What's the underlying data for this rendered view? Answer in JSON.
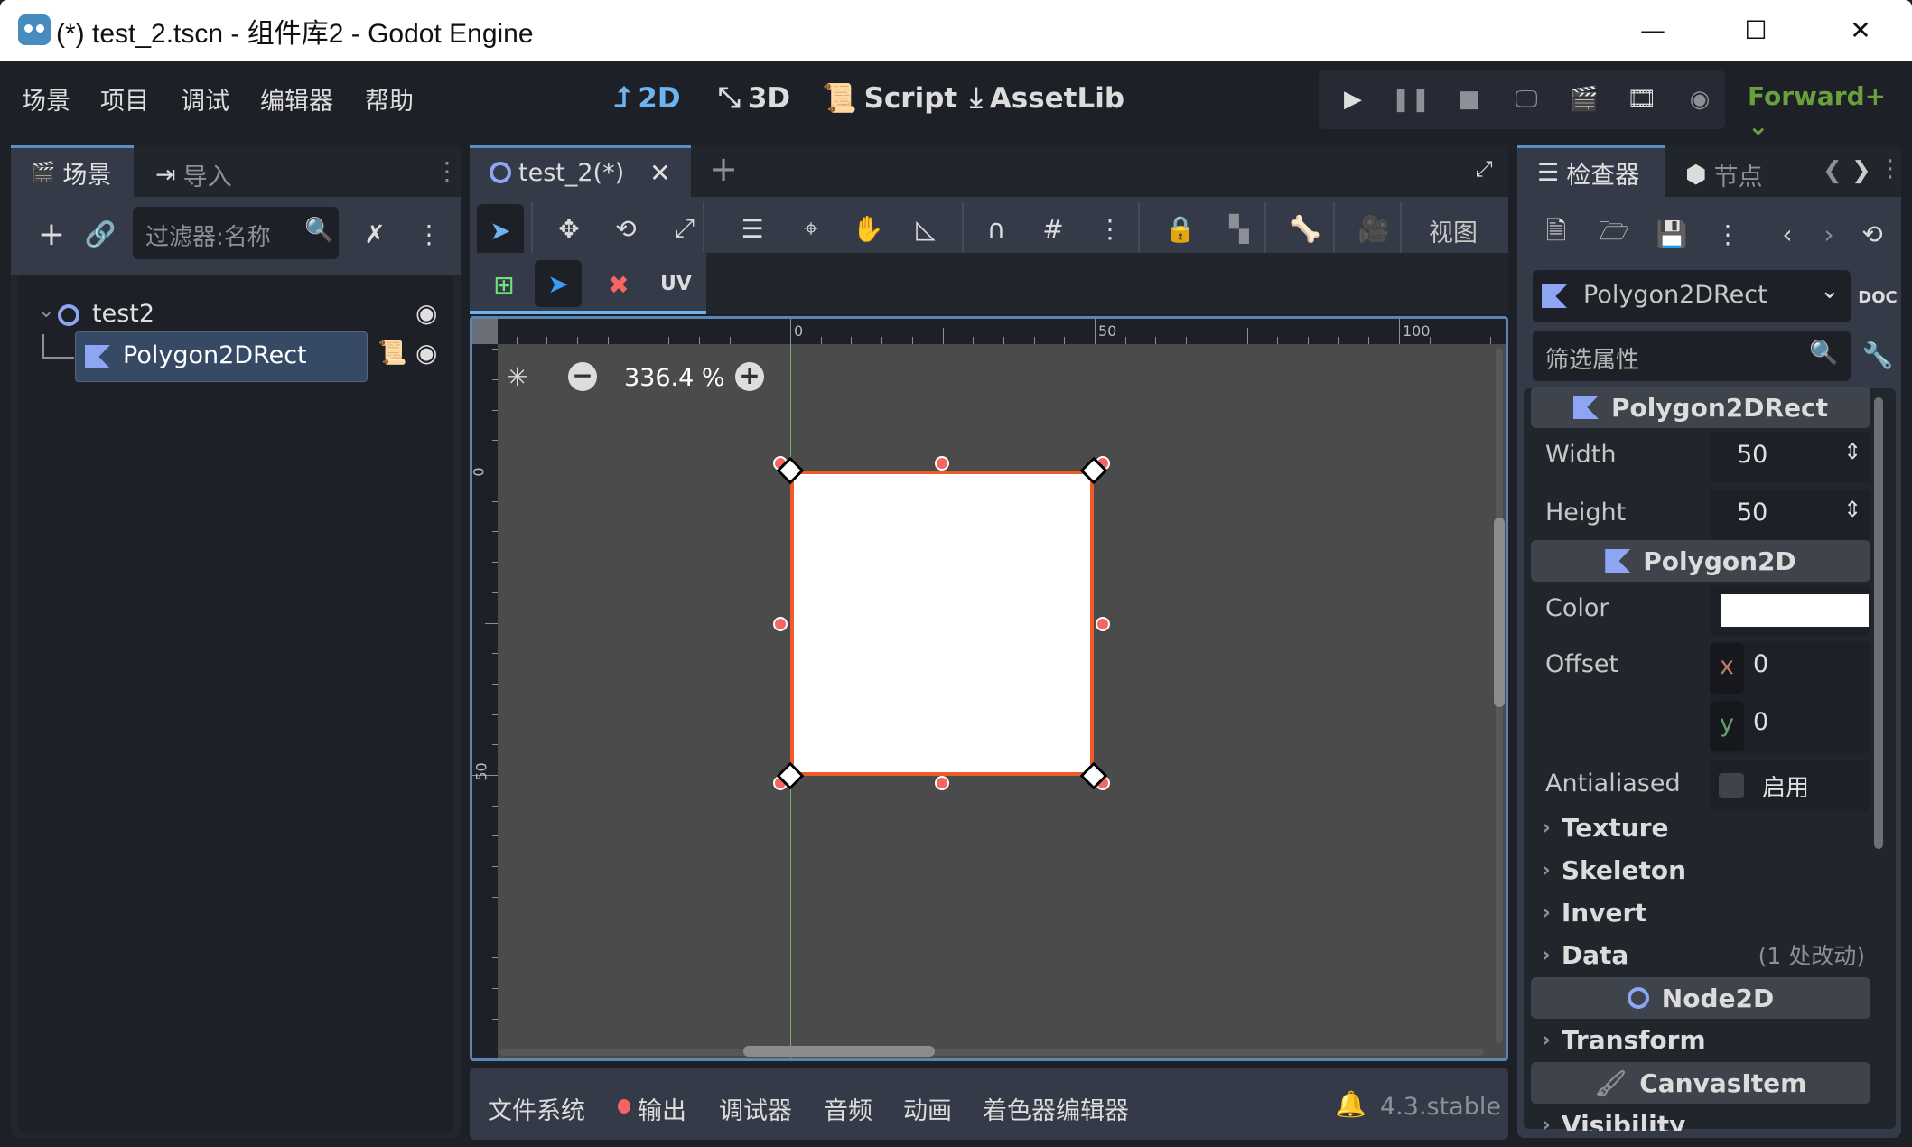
{
  "window": {
    "title": "(*) test_2.tscn - 组件库2 - Godot Engine",
    "controls": {
      "minimize": "—",
      "maximize": "☐",
      "close": "✕"
    }
  },
  "menu": {
    "items": [
      "场景",
      "项目",
      "调试",
      "编辑器",
      "帮助"
    ]
  },
  "workspaces": [
    {
      "label": "2D",
      "icon": "2d-icon",
      "active": true
    },
    {
      "label": "3D",
      "icon": "3d-icon",
      "active": false
    },
    {
      "label": "Script",
      "icon": "script-icon",
      "active": false
    },
    {
      "label": "AssetLib",
      "icon": "assetlib-icon",
      "active": false
    }
  ],
  "run_controls": [
    "play-icon",
    "pause-icon",
    "stop-icon",
    "remote-debug-icon",
    "play-scene-icon",
    "play-custom-scene-icon",
    "movie-maker-icon"
  ],
  "renderer": {
    "label": "Forward+",
    "color": "#6a9f3c"
  },
  "scene_dock": {
    "tabs": [
      {
        "label": "场景",
        "active": true
      },
      {
        "label": "导入",
        "active": false
      }
    ],
    "filter_placeholder": "过滤器:名称",
    "tree": [
      {
        "name": "test2",
        "type": "Node2D",
        "expanded": true,
        "visible": true
      },
      {
        "name": "Polygon2DRect",
        "type": "Polygon2D",
        "selected": true,
        "has_script": true,
        "visible": true
      }
    ]
  },
  "editor": {
    "scene_tab": "test_2(*)",
    "toolbar_view_label": "视图",
    "polygon_tools": {
      "uv_label": "UV"
    },
    "zoom": "336.4 %",
    "ruler": {
      "h_labels": [
        "0",
        "50",
        "100"
      ],
      "v_labels": [
        "0",
        "50"
      ]
    },
    "rect": {
      "width": 50,
      "height": 50,
      "fill": "#ffffff",
      "outline": "#f05a28"
    }
  },
  "bottom_panel": {
    "tabs": [
      "文件系统",
      "输出",
      "调试器",
      "音频",
      "动画",
      "着色器编辑器"
    ],
    "output_indicator_color": "#f76464",
    "version": "4.3.stable"
  },
  "inspector": {
    "tabs": [
      {
        "label": "检查器",
        "active": true
      },
      {
        "label": "节点",
        "active": false
      }
    ],
    "object_selector": "Polygon2DRect",
    "filter_placeholder": "筛选属性",
    "sections": {
      "polygon2drect": "Polygon2DRect",
      "polygon2d": "Polygon2D",
      "node2d": "Node2D",
      "canvasitem": "CanvasItem"
    },
    "properties": {
      "width": {
        "label": "Width",
        "value": "50"
      },
      "height": {
        "label": "Height",
        "value": "50"
      },
      "color": {
        "label": "Color",
        "value": "#ffffff"
      },
      "offset": {
        "label": "Offset",
        "x": "0",
        "y": "0"
      },
      "antialiased": {
        "label": "Antialiased",
        "checkbox_label": "启用",
        "checked": false
      }
    },
    "groups": {
      "texture": "Texture",
      "skeleton": "Skeleton",
      "invert": "Invert",
      "data": "Data",
      "data_note": "(1 处改动)",
      "transform": "Transform",
      "visibility": "Visibility"
    }
  }
}
